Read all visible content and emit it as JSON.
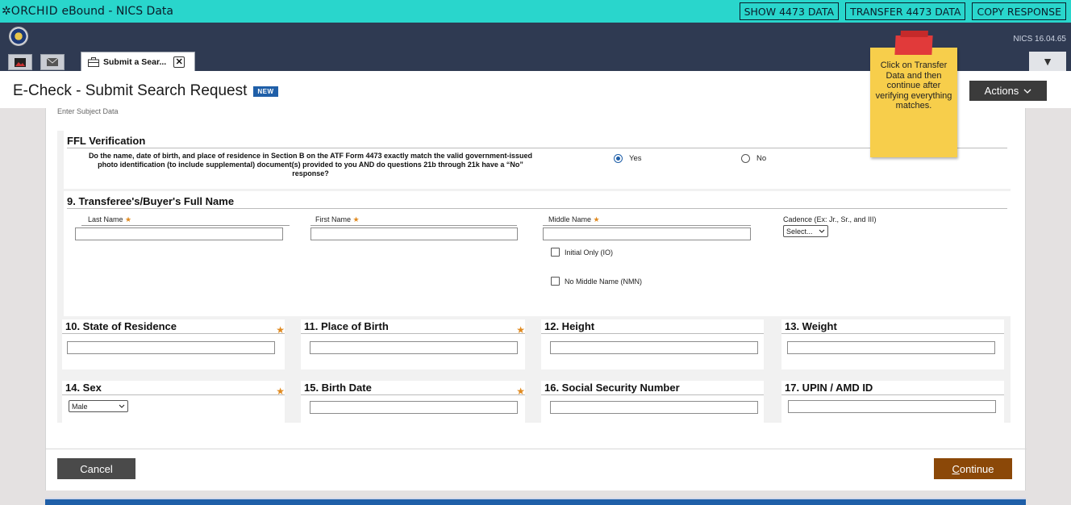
{
  "topbar": {
    "brand": "ORCHID",
    "title_suffix": " eBound - NICS Data",
    "buttons": [
      "SHOW 4473 DATA",
      "TRANSFER 4473 DATA",
      "COPY RESPONSE"
    ]
  },
  "header": {
    "version": "NICS 16.04.65"
  },
  "tabs": {
    "active_label": "Submit a Sear...",
    "close_glyph": "✕"
  },
  "page": {
    "title": "E-Check - Submit Search Request",
    "badge": "NEW",
    "actions_label": "Actions"
  },
  "form": {
    "enter_subject": "Enter Subject Data",
    "ffl": {
      "title": "FFL Verification",
      "question": "Do the name, date of birth, and place of residence in Section B on the ATF Form 4473 exactly match the valid government-issued photo identification (to include supplemental) document(s) provided to you AND do questions 21b through 21k have a “No” response?",
      "yes": "Yes",
      "no": "No",
      "selected": "Yes"
    },
    "name": {
      "title": "9. Transferee's/Buyer's Full Name",
      "last": "Last Name",
      "first": "First Name",
      "middle": "Middle Name",
      "cadence": "Cadence (Ex: Jr., Sr., and III)",
      "cadence_value": "Select...",
      "initial_only": "Initial Only (IO)",
      "no_middle": "No Middle Name (NMN)"
    },
    "fields": {
      "state": "10. State of Residence",
      "pob": "11. Place of Birth",
      "height": "12. Height",
      "weight": "13. Weight",
      "sex": "14. Sex",
      "sex_value": "Male",
      "dob": "15. Birth Date",
      "ssn": "16. Social Security Number",
      "upin": "17. UPIN / AMD ID"
    },
    "cancel": "Cancel",
    "continue_first": "C",
    "continue_rest": "ontinue"
  },
  "sticky_note": "Click on Transfer Data and then continue after verifying everything matches."
}
